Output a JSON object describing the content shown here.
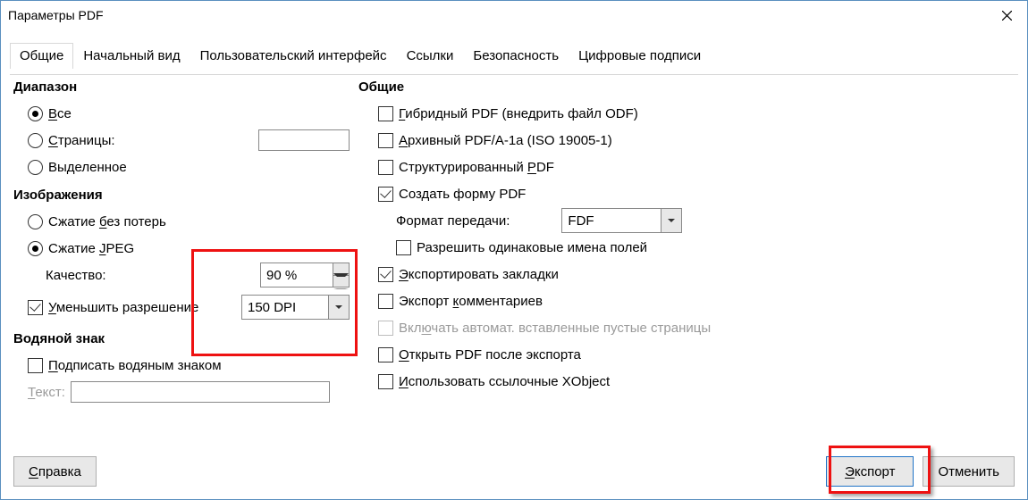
{
  "window": {
    "title": "Параметры PDF"
  },
  "tabs": [
    "Общие",
    "Начальный вид",
    "Пользовательский интерфейс",
    "Ссылки",
    "Безопасность",
    "Цифровые подписи"
  ],
  "left": {
    "range": {
      "title": "Диапазон",
      "all": "се",
      "all_u": "В",
      "pages": "траницы:",
      "pages_u": "С",
      "selection": "Выделенное"
    },
    "images": {
      "title": "Изображения",
      "lossless_pre": "Сжатие ",
      "lossless_u": "б",
      "lossless_post": "ез потерь",
      "jpeg_pre": "Сжатие ",
      "jpeg_u": "J",
      "jpeg_post": "PEG",
      "quality": "Качество:",
      "quality_val": "90 %",
      "reduce_u": "У",
      "reduce": "меньшить разрешение",
      "dpi": "150 DPI"
    },
    "watermark": {
      "title": "Водяной знак",
      "sign_u": "П",
      "sign": "одписать водяным знаком",
      "text_u": "Т",
      "text": "екст:"
    }
  },
  "right": {
    "title": "Общие",
    "hybrid_u": "Г",
    "hybrid": "ибридный PDF (внедрить файл ODF)",
    "arch_u": "А",
    "arch": "рхивный PDF/A-1a (ISO 19005-1)",
    "struct_pre": "Структурированный ",
    "struct_u": "P",
    "struct_post": "DF",
    "form": "Создать форму PDF",
    "transfer": "Формат передачи:",
    "transfer_val": "FDF",
    "dup": "Разрешить одинаковые имена полей",
    "bookmarks_u": "Э",
    "bookmarks": "кспортировать закладки",
    "comments_pre": "Экспорт ",
    "comments_u": "к",
    "comments_post": "омментариев",
    "auto_pre": "Вкл",
    "auto_u": "ю",
    "auto_post": "чать автомат. вставленные пустые страницы",
    "open_u": "О",
    "open": "ткрыть PDF после экспорта",
    "xobj_u": "И",
    "xobj": "спользовать ссылочные XObject"
  },
  "footer": {
    "help_u": "С",
    "help": "правка",
    "export_u": "Э",
    "export": "кспорт",
    "cancel": "Отменить"
  }
}
